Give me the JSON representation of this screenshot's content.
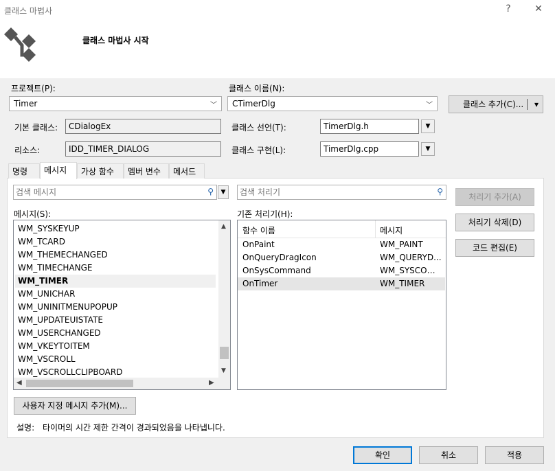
{
  "window": {
    "title": "클래스 마법사",
    "help_glyph": "?",
    "close_glyph": "✕"
  },
  "banner": {
    "title": "클래스 마법사 시작",
    "icon": "class-wizard-logo"
  },
  "project": {
    "label": "프로젝트(P):",
    "value": "Timer"
  },
  "class_name": {
    "label": "클래스 이름(N):",
    "value": "CTimerDlg"
  },
  "add_class_button": {
    "label": "클래스 추가(C)...",
    "arrow": "▾"
  },
  "base_class": {
    "label": "기본 클래스:",
    "value": "CDialogEx"
  },
  "resource": {
    "label": "리소스:",
    "value": "IDD_TIMER_DIALOG"
  },
  "class_decl": {
    "label": "클래스 선언(T):",
    "value": "TimerDlg.h"
  },
  "class_impl": {
    "label": "클래스 구현(L):",
    "value": "TimerDlg.cpp"
  },
  "tabs": [
    {
      "label": "명령",
      "active": false
    },
    {
      "label": "메시지",
      "active": true
    },
    {
      "label": "가상 함수",
      "active": false
    },
    {
      "label": "멤버 변수",
      "active": false
    },
    {
      "label": "메서드",
      "active": false
    }
  ],
  "search_messages": {
    "placeholder": "검색 메시지"
  },
  "search_handlers": {
    "placeholder": "검색 처리기"
  },
  "messages_label": "메시지(S):",
  "messages": [
    {
      "name": "WM_SYSKEYUP",
      "selected": false
    },
    {
      "name": "WM_TCARD",
      "selected": false
    },
    {
      "name": "WM_THEMECHANGED",
      "selected": false
    },
    {
      "name": "WM_TIMECHANGE",
      "selected": false
    },
    {
      "name": "WM_TIMER",
      "selected": true
    },
    {
      "name": "WM_UNICHAR",
      "selected": false
    },
    {
      "name": "WM_UNINITMENUPOPUP",
      "selected": false
    },
    {
      "name": "WM_UPDATEUISTATE",
      "selected": false
    },
    {
      "name": "WM_USERCHANGED",
      "selected": false
    },
    {
      "name": "WM_VKEYTOITEM",
      "selected": false
    },
    {
      "name": "WM_VSCROLL",
      "selected": false
    },
    {
      "name": "WM_VSCROLLCLIPBOARD",
      "selected": false
    }
  ],
  "handlers_label": "기존 처리기(H):",
  "handlers_columns": [
    "함수 이름",
    "메시지"
  ],
  "handlers": [
    {
      "func": "OnPaint",
      "msg": "WM_PAINT",
      "selected": false
    },
    {
      "func": "OnQueryDragIcon",
      "msg": "WM_QUERYD...",
      "selected": false
    },
    {
      "func": "OnSysCommand",
      "msg": "WM_SYSCOM...",
      "selected": false
    },
    {
      "func": "OnTimer",
      "msg": "WM_TIMER",
      "selected": true
    }
  ],
  "side_buttons": {
    "add": "처리기 추가(A)",
    "delete": "처리기 삭제(D)",
    "edit": "코드 편집(E)"
  },
  "custom_message_button": "사용자 지정 메시지 추가(M)...",
  "description": {
    "label": "설명:",
    "text": "타이머의 시간 제한 간격이 경과되었음을 나타냅니다."
  },
  "footer": {
    "ok": "확인",
    "cancel": "취소",
    "apply": "적용"
  }
}
